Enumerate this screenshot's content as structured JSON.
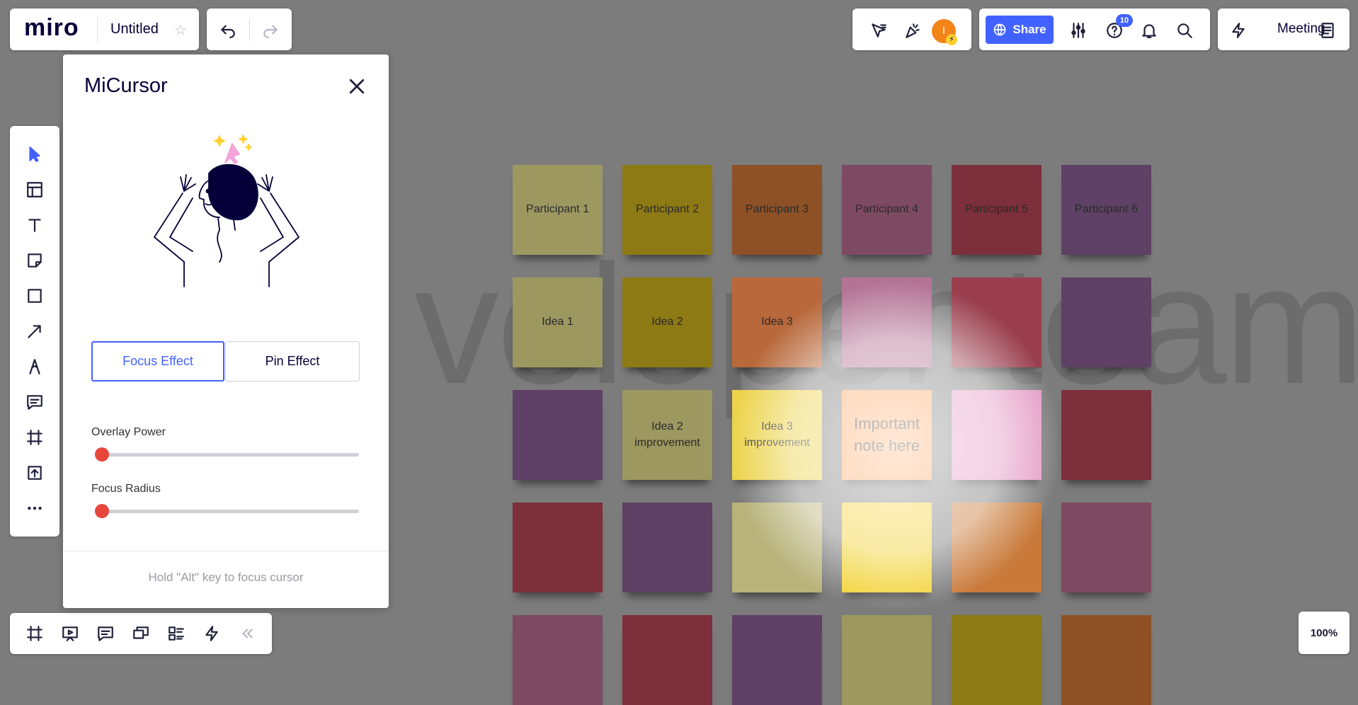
{
  "header": {
    "logo": "miro",
    "board_title": "Untitled",
    "share_label": "Share",
    "help_badge": "10",
    "meeting_label": "Meeting",
    "avatar_initial": "I"
  },
  "canvas": {
    "watermark": "veloper team",
    "zoom": "100%",
    "sticky_notes": [
      {
        "text": "Participant 1",
        "color": "#9c9860"
      },
      {
        "text": "Participant 2",
        "color": "#8e7a14"
      },
      {
        "text": "Participant 3",
        "color": "#8e5126"
      },
      {
        "text": "Participant 4",
        "color": "#7e4a62"
      },
      {
        "text": "Participant 5",
        "color": "#7d2f3b"
      },
      {
        "text": "Participant 6",
        "color": "#5e4164"
      },
      {
        "text": "Idea 1",
        "color": "#9c9860"
      },
      {
        "text": "Idea 2",
        "color": "#8e7a14"
      },
      {
        "text": "Idea 3",
        "color": "#b8683a"
      },
      {
        "text": "",
        "color": "#b37393"
      },
      {
        "text": "",
        "color": "#9a3e4e"
      },
      {
        "text": "",
        "color": "#5e4164"
      },
      {
        "text": "",
        "color": "#5e4164"
      },
      {
        "text": "Idea 2 improvement",
        "color": "#9c9860"
      },
      {
        "text": "Idea 3 improvement",
        "color": "#ecd34a"
      },
      {
        "text": "Important note here",
        "color": "#fea55f"
      },
      {
        "text": "",
        "color": "#e49bc4"
      },
      {
        "text": "",
        "color": "#7d2f3b"
      },
      {
        "text": "",
        "color": "#7d2f3b"
      },
      {
        "text": "",
        "color": "#5e4164"
      },
      {
        "text": "",
        "color": "#b8b37a"
      },
      {
        "text": "",
        "color": "#f2d338"
      },
      {
        "text": "",
        "color": "#c97a3a"
      },
      {
        "text": "",
        "color": "#7e4a62"
      },
      {
        "text": "",
        "color": "#7e4a62"
      },
      {
        "text": "",
        "color": "#7d2f3b"
      },
      {
        "text": "",
        "color": "#5e4164"
      },
      {
        "text": "",
        "color": "#9c9860"
      },
      {
        "text": "",
        "color": "#8e7a14"
      },
      {
        "text": "",
        "color": "#8e5126"
      }
    ]
  },
  "micursor": {
    "title": "MiCursor",
    "tab_focus": "Focus Effect",
    "tab_pin": "Pin Effect",
    "overlay_label": "Overlay Power",
    "radius_label": "Focus Radius",
    "overlay_value": 0,
    "radius_value": 0,
    "hint": "Hold \"Alt\" key to focus cursor"
  }
}
